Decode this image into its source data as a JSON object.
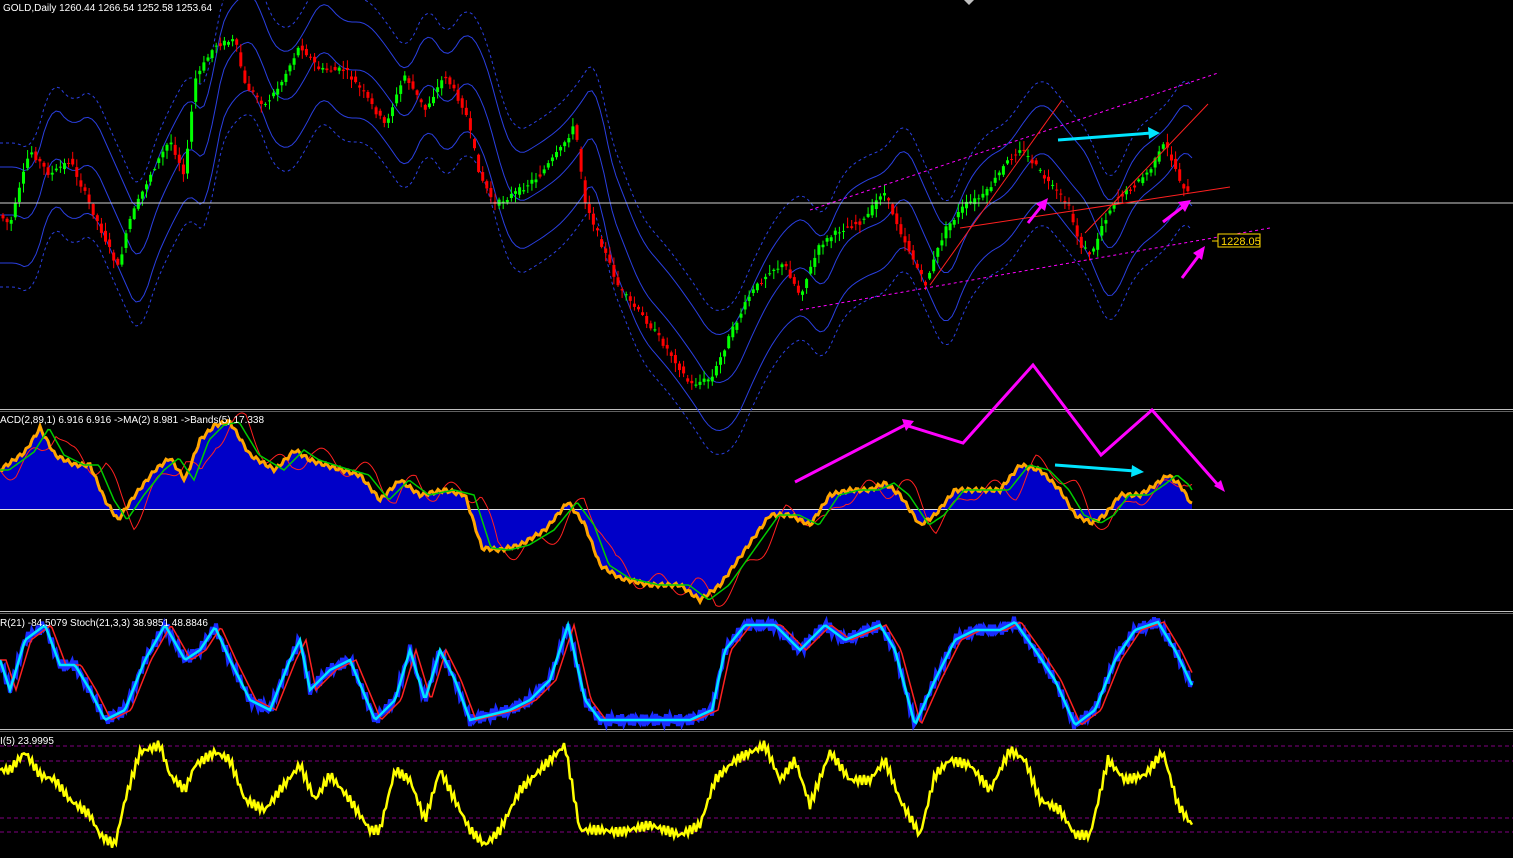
{
  "colors": {
    "background": "#000000",
    "bull": "#00ff00",
    "bear": "#ff0000",
    "band": "#2a3fe0",
    "histogram": "#0000c8",
    "macd_main": "#ffa500",
    "macd_signal": "#00cc00",
    "wpr": "#1a2cff",
    "stoch_main": "#00e5ff",
    "stoch_signal": "#ff2020",
    "rsi": "#ffff00",
    "annotation_pink": "#ff00ff",
    "annotation_cyan": "#00e5ff",
    "price_label": "#ffd700"
  },
  "main_chart": {
    "header": "GOLD,Daily  1260.44 1266.54 1252.58 1253.64",
    "price_label": "1228.05"
  },
  "macd_panel": {
    "header": "ACD(2,89,1) 6.916 6.916  ->MA(2) 8.981  ->Bands(5) 17.338"
  },
  "stoch_panel": {
    "header": "R(21) -84.5079  Stoch(21,3,3) 38.9851 48.8846"
  },
  "rsi_panel": {
    "header": "I(5) 23.9995"
  }
}
